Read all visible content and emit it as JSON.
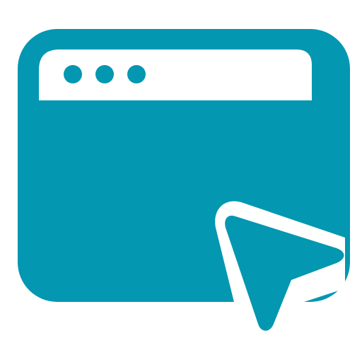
{
  "icon": {
    "name": "browser-window-click-icon",
    "parts": [
      "browser-window-icon",
      "window-dot-icon",
      "cursor-arrow-icon"
    ],
    "colors": {
      "primary": "#0397B1",
      "background": "#FFFFFF"
    }
  }
}
